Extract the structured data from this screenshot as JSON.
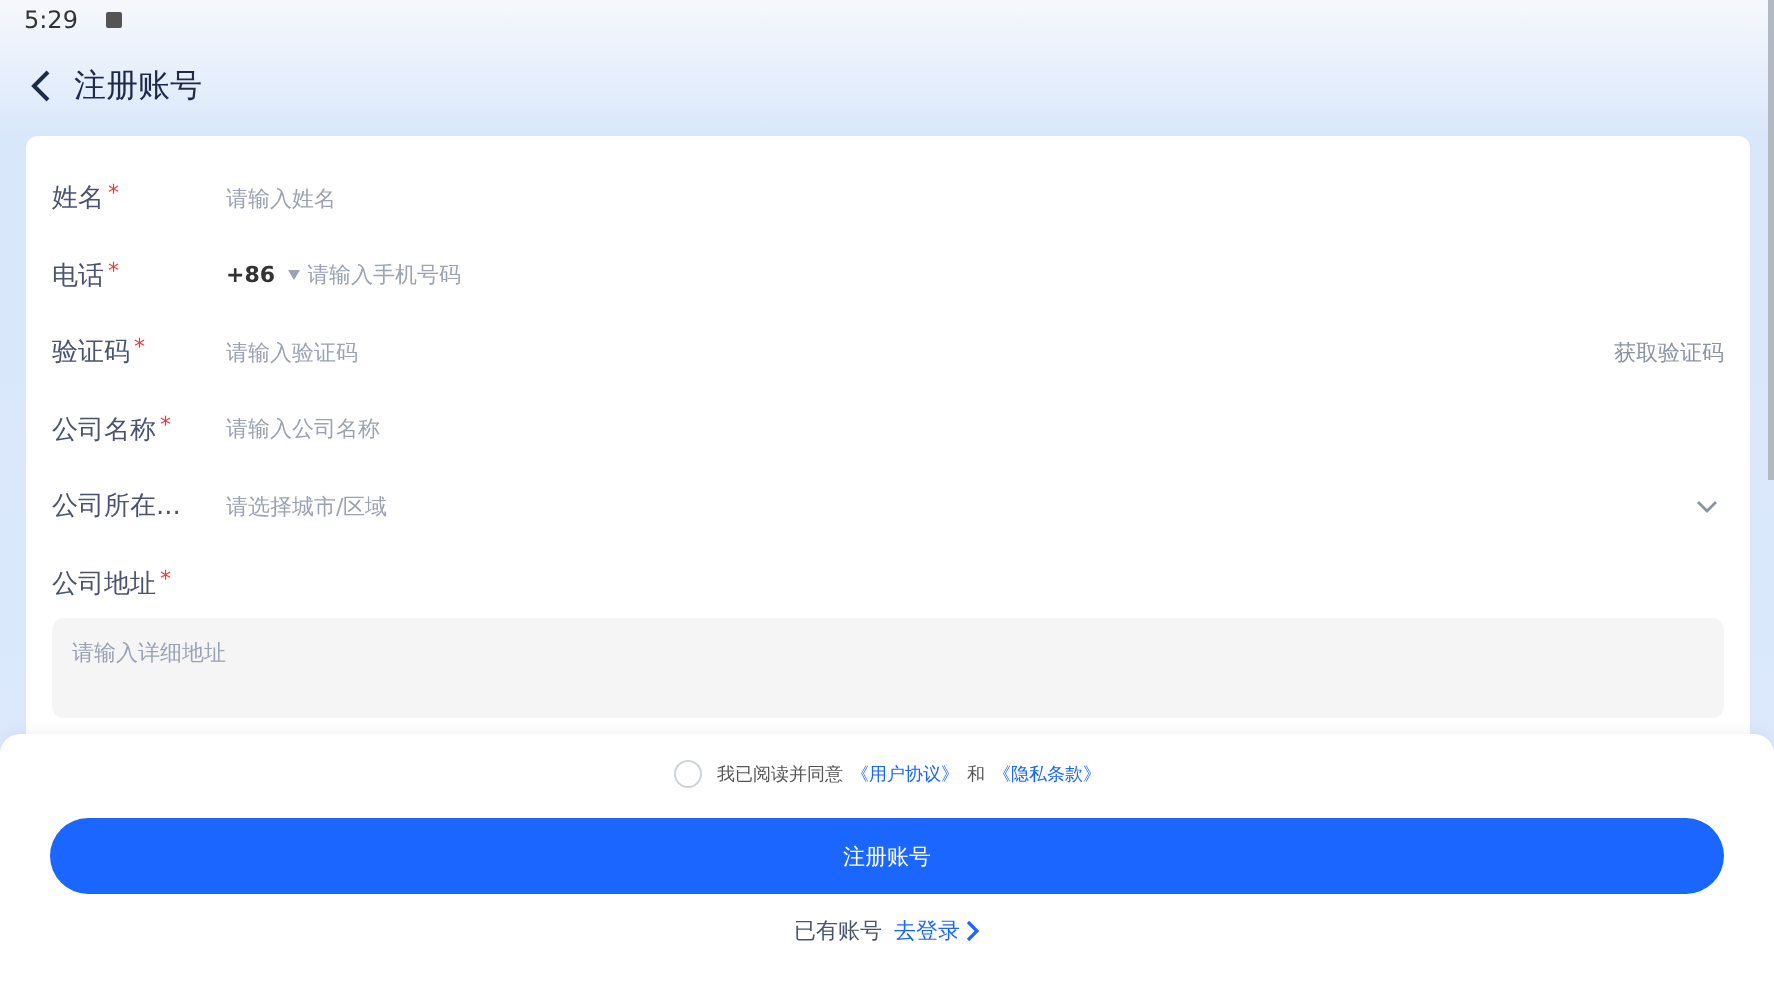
{
  "status_bar": {
    "time": "5:29"
  },
  "header": {
    "title": "注册账号"
  },
  "fields": [
    {
      "kind": "text",
      "label": "姓名",
      "required_mark": "*",
      "placeholder": "请输入姓名"
    },
    {
      "kind": "phone",
      "label": "电话",
      "required_mark": "*",
      "prefix": "+86",
      "placeholder": "请输入手机号码"
    },
    {
      "kind": "code",
      "label": "验证码",
      "required_mark": "*",
      "placeholder": "请输入验证码",
      "action": "获取验证码"
    },
    {
      "kind": "text",
      "label": "公司名称",
      "required_mark": "*",
      "placeholder": "请输入公司名称"
    },
    {
      "kind": "select",
      "label": "公司所在...",
      "placeholder": "请选择城市/区域"
    },
    {
      "kind": "textarea",
      "label": "公司地址",
      "required_mark": "*",
      "placeholder": "请输入详细地址"
    }
  ],
  "agreement": {
    "checked": false,
    "text": "我已阅读并同意",
    "link_1": "《用户协议》",
    "joiner": "和",
    "link_2": "《隐私条款》"
  },
  "submit_button": "注册账号",
  "login": {
    "text": "已有账号",
    "link": "去登录"
  }
}
